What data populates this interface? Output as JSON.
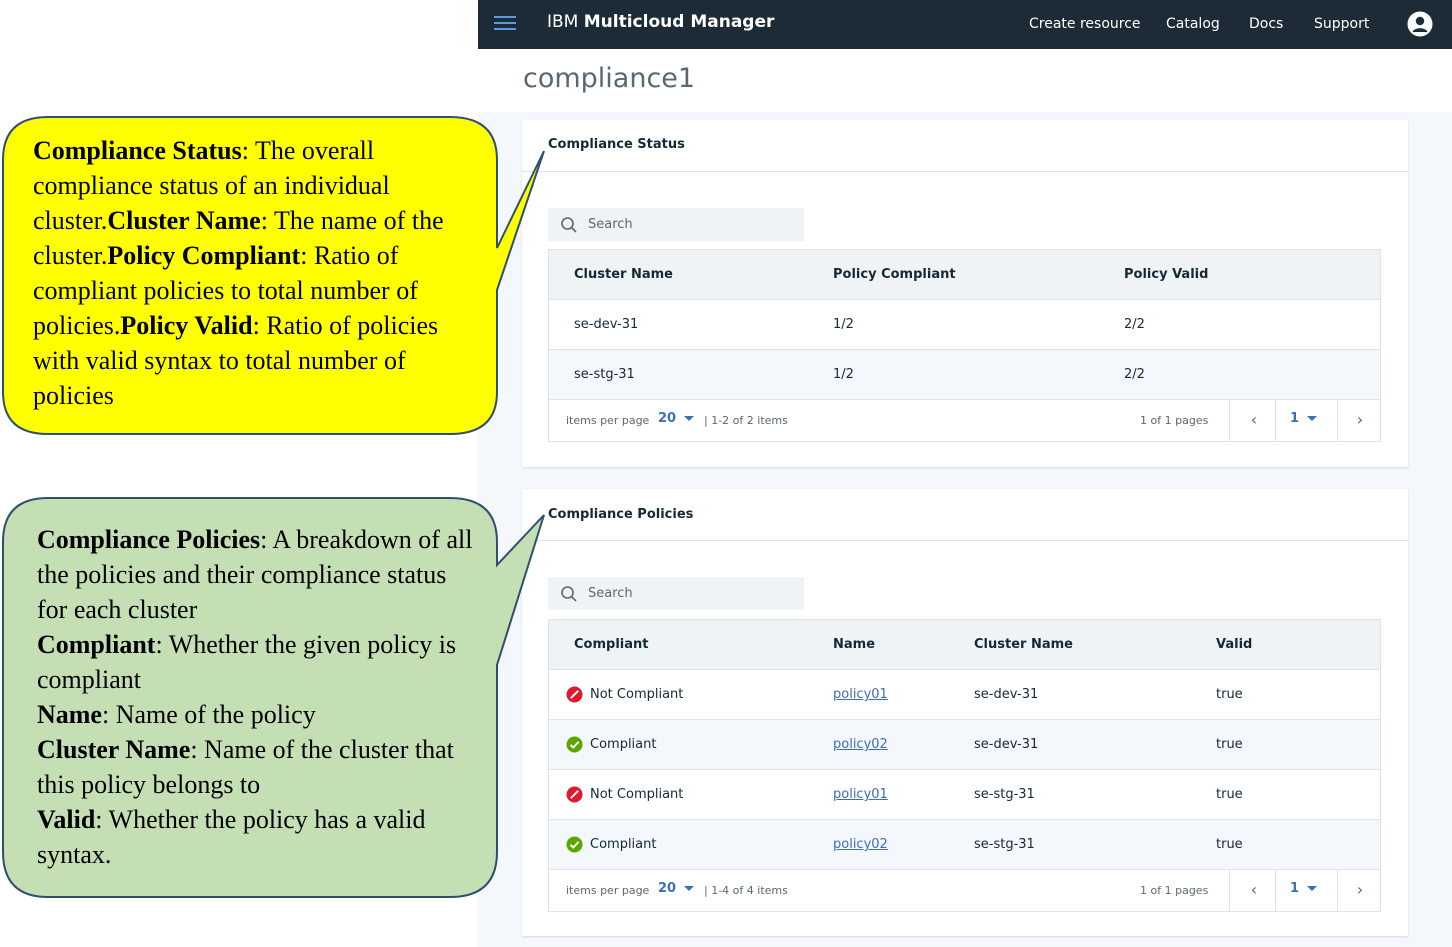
{
  "topbar": {
    "brand_prefix": "IBM",
    "brand_name": "Multicloud Manager",
    "nav": [
      "Create resource",
      "Catalog",
      "Docs",
      "Support"
    ]
  },
  "page": {
    "title": "compliance1"
  },
  "status_card": {
    "title": "Compliance Status",
    "search_placeholder": "Search",
    "columns": [
      "Cluster Name",
      "Policy Compliant",
      "Policy Valid"
    ],
    "rows": [
      {
        "cluster": "se-dev-31",
        "compliant": "1/2",
        "valid": "2/2"
      },
      {
        "cluster": "se-stg-31",
        "compliant": "1/2",
        "valid": "2/2"
      }
    ],
    "pagination": {
      "items_per_page_label": "items per page",
      "items_per_page": "20",
      "range": "|  1-2 of 2 items",
      "pages": "1 of 1 pages",
      "current_page": "1"
    }
  },
  "policies_card": {
    "title": "Compliance Policies",
    "search_placeholder": "Search",
    "columns": [
      "Compliant",
      "Name",
      "Cluster Name",
      "Valid"
    ],
    "rows": [
      {
        "status": "Not Compliant",
        "name": "policy01",
        "cluster": "se-dev-31",
        "valid": "true"
      },
      {
        "status": "Compliant",
        "name": "policy02",
        "cluster": "se-dev-31",
        "valid": "true"
      },
      {
        "status": "Not Compliant",
        "name": "policy01",
        "cluster": "se-stg-31",
        "valid": "true"
      },
      {
        "status": "Compliant",
        "name": "policy02",
        "cluster": "se-stg-31",
        "valid": "true"
      }
    ],
    "pagination": {
      "items_per_page_label": "items per page",
      "items_per_page": "20",
      "range": "|  1-4 of 4 items",
      "pages": "1 of 1 pages",
      "current_page": "1"
    }
  },
  "callouts": {
    "status": {
      "t1": "Compliance Status",
      "t2": ": The overall compliance status of an individual cluster.",
      "t3": "Cluster Name",
      "t4": ": The name of the cluster.",
      "t5": "Policy Compliant",
      "t6": ": Ratio of compliant policies to total number of policies.",
      "t7": "Policy Valid",
      "t8": ": Ratio of policies with valid syntax to total number of policies"
    },
    "policies": {
      "t1": "Compliance Policies",
      "t2": ": A breakdown of all the policies and their compliance status for each cluster",
      "t3": "Compliant",
      "t4": ": Whether the given policy is compliant",
      "t5": "Name",
      "t6": ": Name of the policy",
      "t7": "Cluster Name",
      "t8": ": Name of the cluster that this policy belongs to",
      "t9": "Valid",
      "t10": ": Whether the policy has a valid syntax."
    }
  },
  "colors": {
    "header_bg": "#1d2b36",
    "link": "#3d70b2",
    "not_compliant": "#e0182d",
    "compliant": "#5aa700",
    "callout_yellow": "#ffff00",
    "callout_green": "#c5dfb4"
  }
}
